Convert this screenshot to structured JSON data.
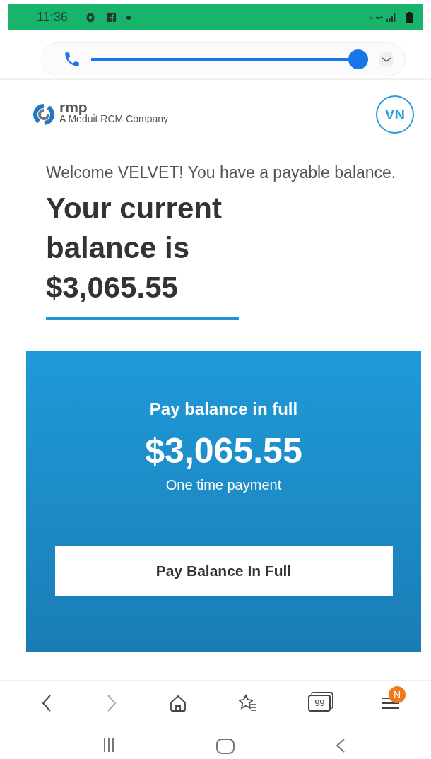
{
  "status_bar": {
    "time": "11:36",
    "network": "LTE+"
  },
  "browser_bar": {
    "call_slider": {
      "level": 1
    }
  },
  "header": {
    "logo_text": "rmp",
    "logo_tagline": "A Meduit RCM Company",
    "avatar": "VN"
  },
  "welcome": "Welcome VELVET! You have a payable balance.",
  "balance_heading": "Your current balance is $3,065.55",
  "pay_card": {
    "title": "Pay balance in full",
    "amount": "$3,065.55",
    "subtitle": "One time payment",
    "button": "Pay Balance In Full"
  },
  "bottom_nav": {
    "tabs_count": "99",
    "menu_badge": "N"
  }
}
